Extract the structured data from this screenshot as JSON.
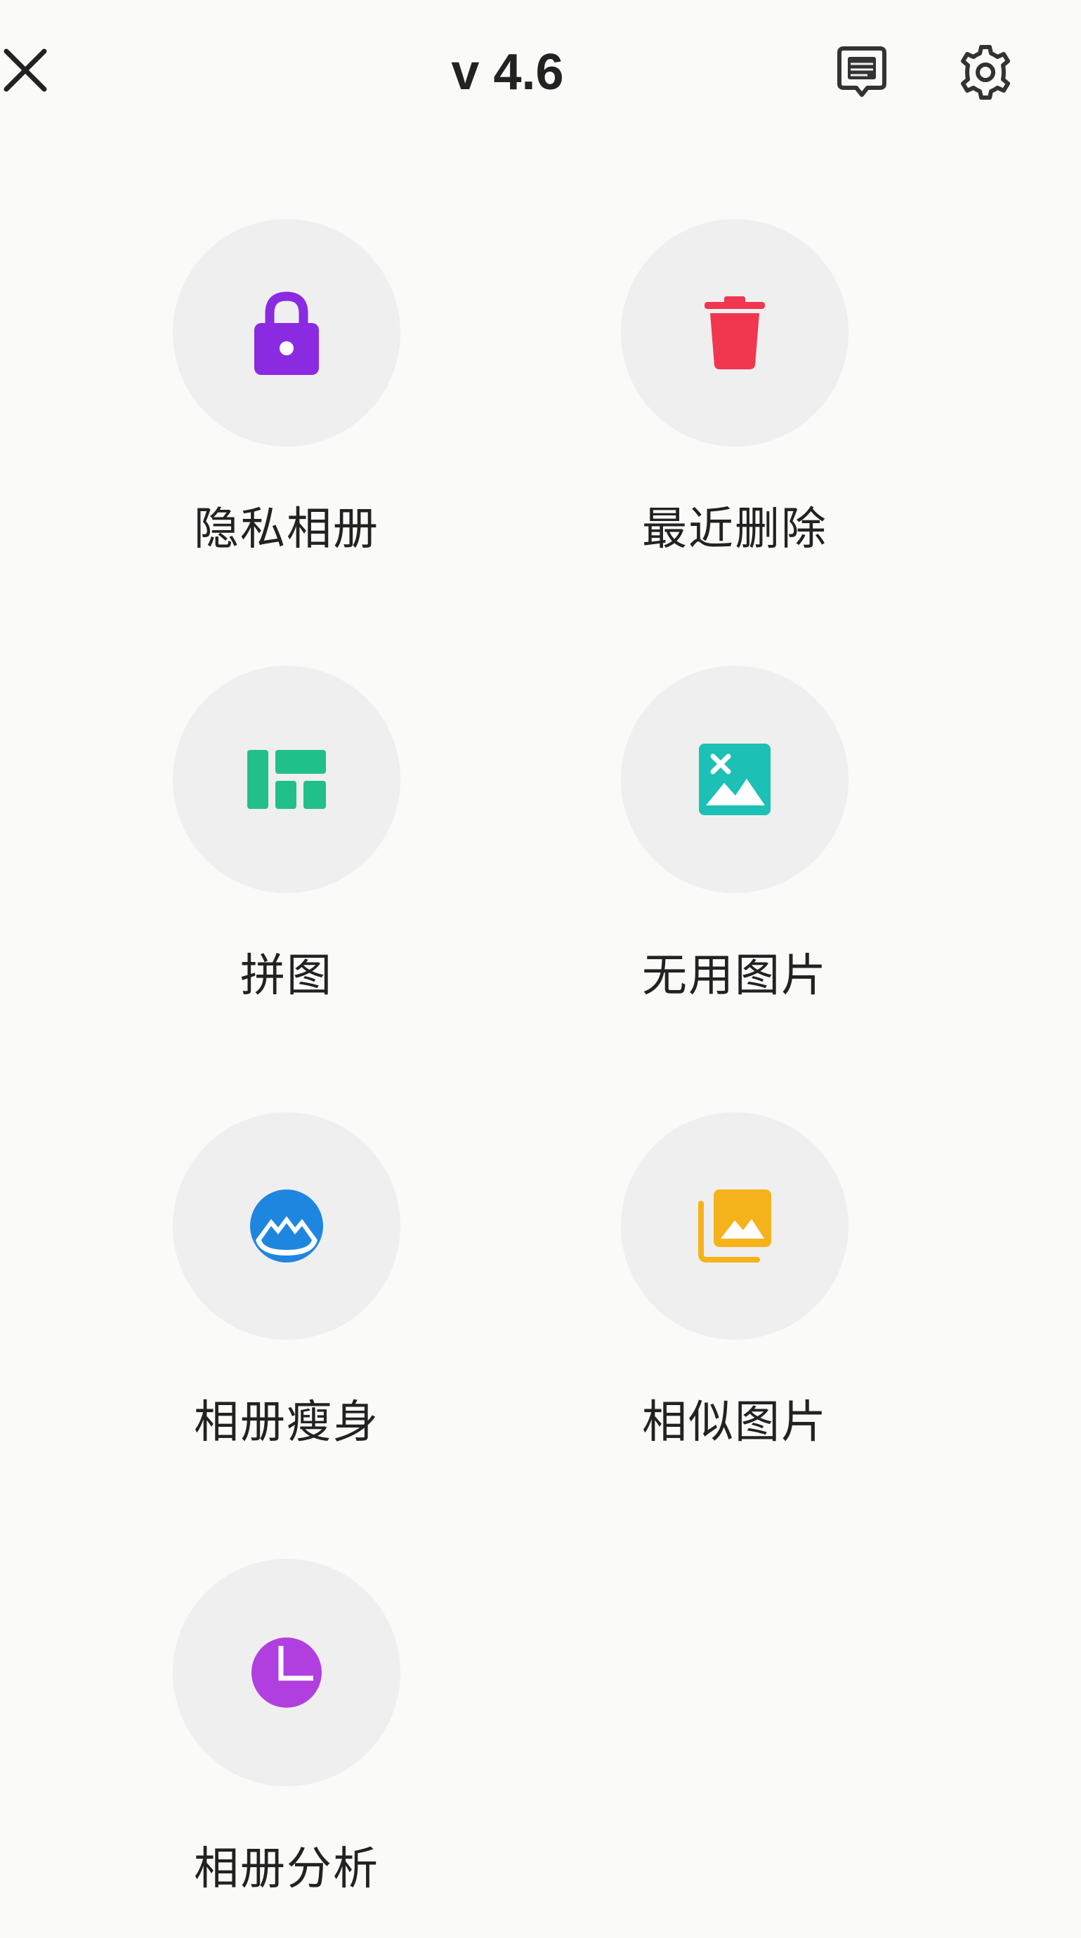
{
  "header": {
    "version": "v 4.6",
    "icons": {
      "close": "close-icon",
      "feedback": "feedback-icon",
      "settings": "gear-icon"
    }
  },
  "features": [
    {
      "label": "隐私相册",
      "icon": "lock-icon",
      "color": "#8a2be2"
    },
    {
      "label": "最近删除",
      "icon": "trash-icon",
      "color": "#f0374f"
    },
    {
      "label": "拼图",
      "icon": "collage-icon",
      "color": "#21c08b"
    },
    {
      "label": "无用图片",
      "icon": "broken-image-icon",
      "color": "#1cc0b5"
    },
    {
      "label": "相册瘦身",
      "icon": "slim-icon",
      "color": "#1f86e0"
    },
    {
      "label": "相似图片",
      "icon": "similar-images-icon",
      "color": "#f5b21a"
    },
    {
      "label": "相册分析",
      "icon": "pie-chart-icon",
      "color": "#b13fe0"
    }
  ]
}
